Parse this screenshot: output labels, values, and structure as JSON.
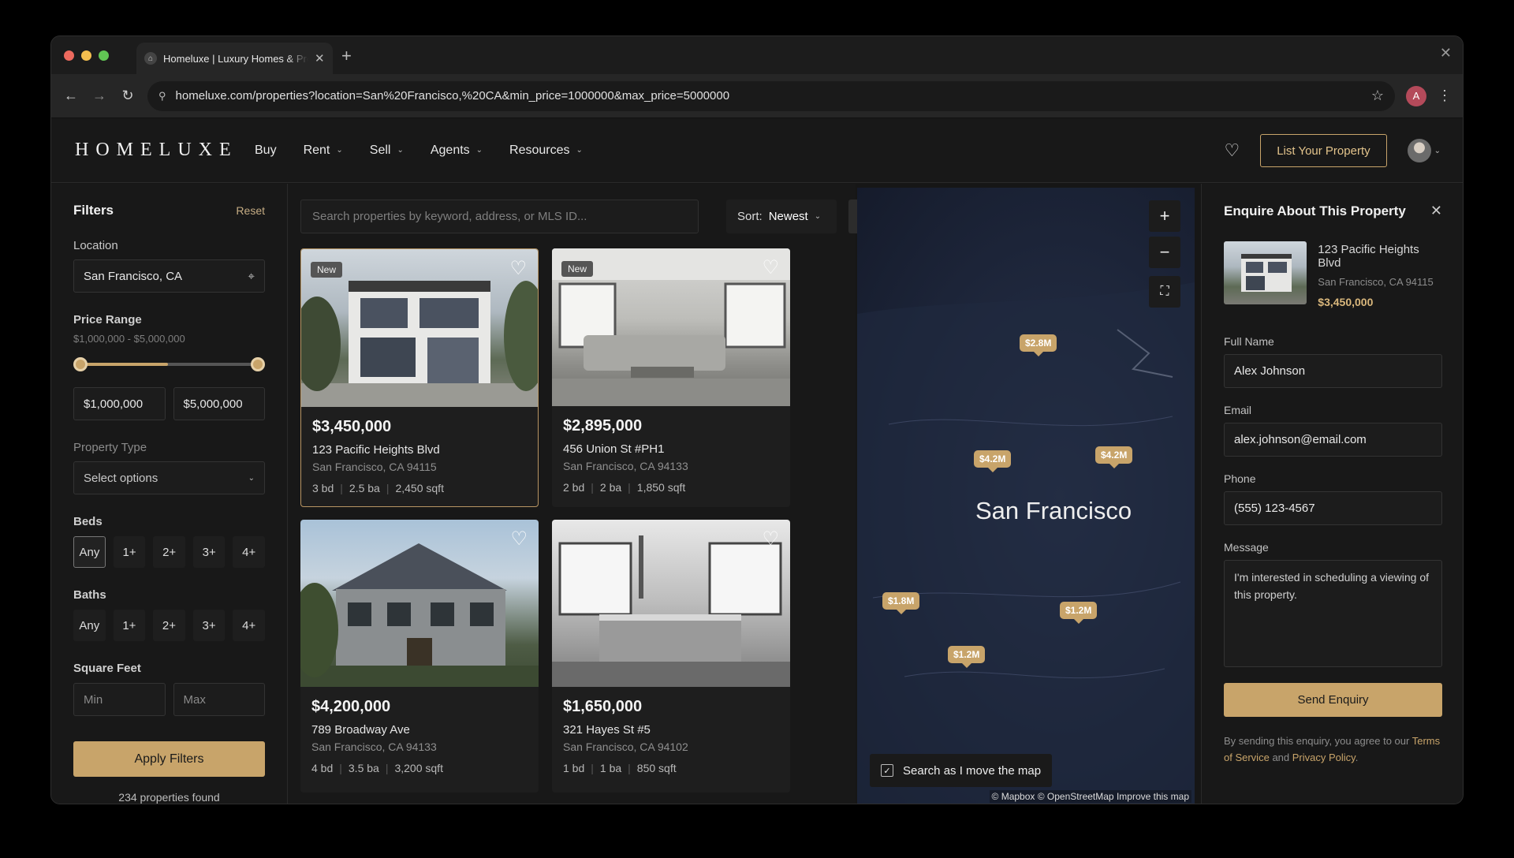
{
  "browser": {
    "tab_title": "Homeluxe | Luxury Homes & Properties",
    "url": "homeluxe.com/properties?location=San%20Francisco,%20CA&min_price=1000000&max_price=5000000"
  },
  "header": {
    "logo": "HOMELUXE",
    "nav": [
      "Buy",
      "Rent",
      "Sell",
      "Agents",
      "Resources"
    ],
    "list_button": "List Your Property"
  },
  "filters": {
    "title": "Filters",
    "reset": "Reset",
    "location_label": "Location",
    "location_value": "San Francisco, CA",
    "price_label": "Price Range",
    "price_range_text": "$1,000,000 - $5,000,000",
    "price_min": "$1,000,000",
    "price_max": "$5,000,000",
    "type_label": "Property Type",
    "type_placeholder": "Select options",
    "beds_label": "Beds",
    "beds_options": [
      "Any",
      "1+",
      "2+",
      "3+",
      "4+"
    ],
    "baths_label": "Baths",
    "baths_options": [
      "Any",
      "1+",
      "2+",
      "3+",
      "4+"
    ],
    "sqft_label": "Square Feet",
    "sqft_min_placeholder": "Min",
    "sqft_max_placeholder": "Max",
    "apply_button": "Apply Filters",
    "results_count": "234 properties found"
  },
  "listings": {
    "search_placeholder": "Search properties by keyword, address, or MLS ID...",
    "sort_label": "Sort:",
    "sort_value": "Newest",
    "cards": [
      {
        "badge": "New",
        "price": "$3,450,000",
        "address": "123 Pacific Heights Blvd",
        "city": "San Francisco, CA 94115",
        "beds": "3 bd",
        "baths": "2.5 ba",
        "sqft": "2,450 sqft"
      },
      {
        "badge": "New",
        "price": "$2,895,000",
        "address": "456 Union St #PH1",
        "city": "San Francisco, CA 94133",
        "beds": "2 bd",
        "baths": "2 ba",
        "sqft": "1,850 sqft"
      },
      {
        "badge": "",
        "price": "$4,200,000",
        "address": "789 Broadway Ave",
        "city": "San Francisco, CA 94133",
        "beds": "4 bd",
        "baths": "3.5 ba",
        "sqft": "3,200 sqft"
      },
      {
        "badge": "",
        "price": "$1,650,000",
        "address": "321 Hayes St #5",
        "city": "San Francisco, CA 94102",
        "beds": "1 bd",
        "baths": "1 ba",
        "sqft": "850 sqft"
      }
    ]
  },
  "map": {
    "city_label": "San Francisco",
    "markers": [
      "$2.8M",
      "$4.2M",
      "$4.2M",
      "$1.8M",
      "$1.2M",
      "$1.2M"
    ],
    "search_toggle": "Search as I move the map",
    "attribution": "© Mapbox © OpenStreetMap",
    "improve_link": "Improve this map"
  },
  "enquiry": {
    "title": "Enquire About This Property",
    "property_name": "123 Pacific Heights Blvd",
    "property_city": "San Francisco, CA 94115",
    "property_price": "$3,450,000",
    "name_label": "Full Name",
    "name_value": "Alex Johnson",
    "email_label": "Email",
    "email_value": "alex.johnson@email.com",
    "phone_label": "Phone",
    "phone_value": "(555) 123-4567",
    "message_label": "Message",
    "message_value": "I'm interested in scheduling a viewing of this property.",
    "send_button": "Send Enquiry",
    "legal_prefix": "By sending this enquiry, you agree to our",
    "terms_link": "Terms of Service",
    "legal_and": "and",
    "privacy_link": "Privacy Policy",
    "legal_end": "."
  },
  "colors": {
    "accent": "#c8a46a",
    "background": "#181818"
  }
}
